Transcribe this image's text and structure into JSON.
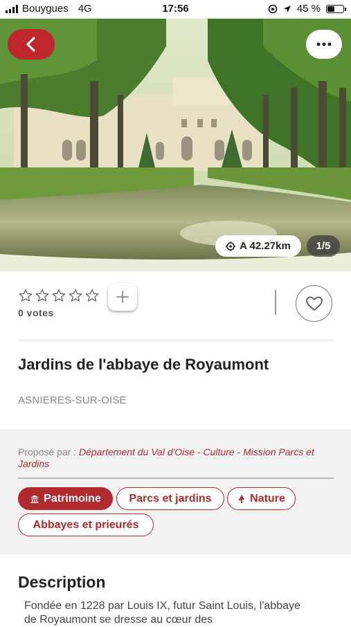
{
  "status_bar": {
    "carrier": "Bouygues",
    "network": "4G",
    "time": "17:56",
    "battery": "45 %",
    "battery_level": 0.45
  },
  "hero": {
    "distance": "A 42.27km",
    "photo_counter": "1/5"
  },
  "rating": {
    "stars_filled": 0,
    "stars_total": 5,
    "votes": "0 votes"
  },
  "place": {
    "title": "Jardins de l'abbaye de Royaumont",
    "city": "ASNIERES-SUR-OISE"
  },
  "proposer": {
    "label": "Proposé par : ",
    "name": "Département du Val d'Oise - Culture - Mission Parcs et Jardins"
  },
  "tags": [
    {
      "label": "Patrimoine",
      "icon": "monument-icon",
      "active": true
    },
    {
      "label": "Parcs et jardins",
      "active": false
    },
    {
      "label": "Nature",
      "icon": "tree-icon",
      "active": false
    },
    {
      "label": "Abbayes et prieurés",
      "active": false
    }
  ],
  "description": {
    "heading": "Description",
    "text": "Fondée en 1228 par Louis IX, futur Saint Louis, l'abbaye de Royaumont se dresse au cœur des"
  },
  "colors": {
    "accent": "#b12a2e",
    "back_button": "#c0272d"
  }
}
